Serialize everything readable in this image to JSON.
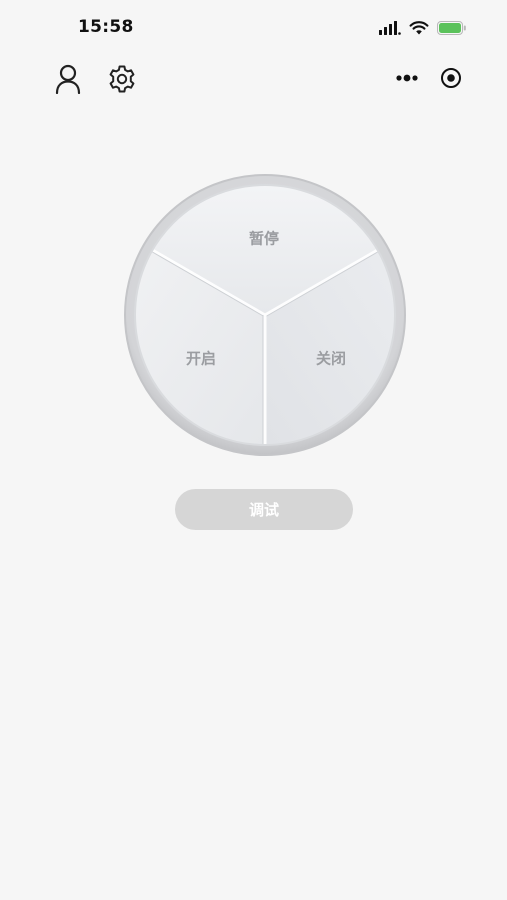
{
  "status_bar": {
    "time": "15:58",
    "icons": [
      "signal-icon",
      "wifi-icon",
      "battery-icon"
    ],
    "battery_color": "#5bc25b"
  },
  "nav": {
    "left_icons": [
      "user-icon",
      "settings-icon"
    ],
    "capsule_icons": [
      "more-dots-icon",
      "record-target-icon"
    ]
  },
  "dial": {
    "top_label": "暂停",
    "left_label": "开启",
    "right_label": "关闭"
  },
  "debug_button": {
    "label": "调试"
  }
}
